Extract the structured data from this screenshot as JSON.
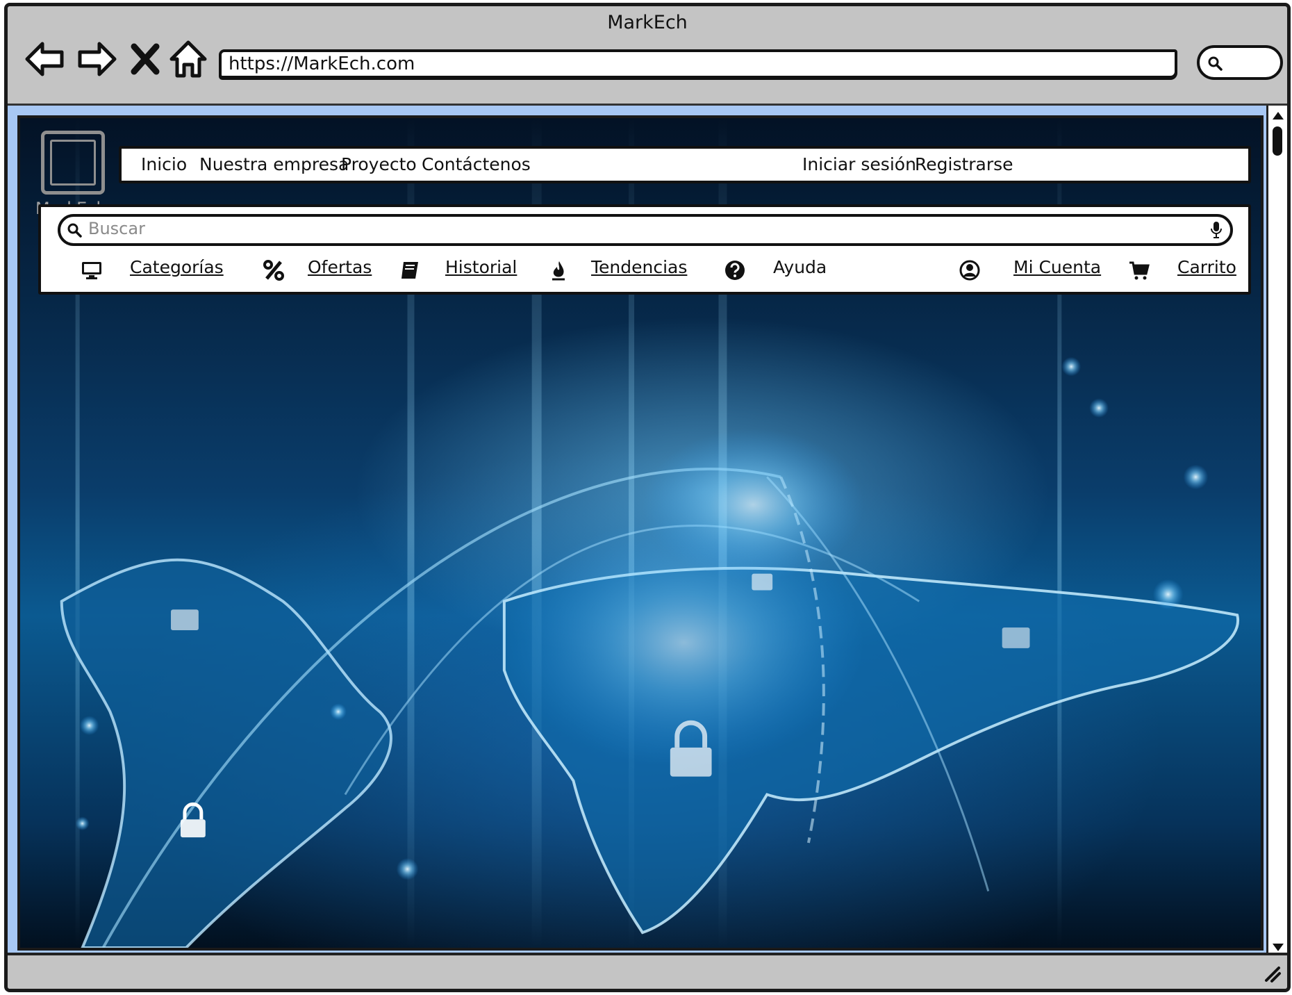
{
  "browser": {
    "window_title": "MarkEch",
    "url": "https://MarkEch.com",
    "icons": [
      "back-arrow-icon",
      "forward-arrow-icon",
      "stop-icon",
      "home-icon",
      "search-icon"
    ]
  },
  "site": {
    "logo_text": "MarkEch",
    "topnav": {
      "items": [
        "Inicio",
        "Nuestra empresa",
        "Proyecto",
        "Contáctenos"
      ],
      "login": "Iniciar sesión",
      "register": "Registrarse"
    },
    "search": {
      "placeholder": "Buscar"
    },
    "toolbar": {
      "categories": "Categorías",
      "offers": "Ofertas",
      "history": "Historial",
      "trends": "Tendencias",
      "help": "Ayuda",
      "account": "Mi Cuenta",
      "cart": "Carrito"
    }
  },
  "colors": {
    "viewport_border": "#a8c8f4",
    "chrome": "#c4c4c4",
    "hero_accent": "#2aa7ff"
  }
}
